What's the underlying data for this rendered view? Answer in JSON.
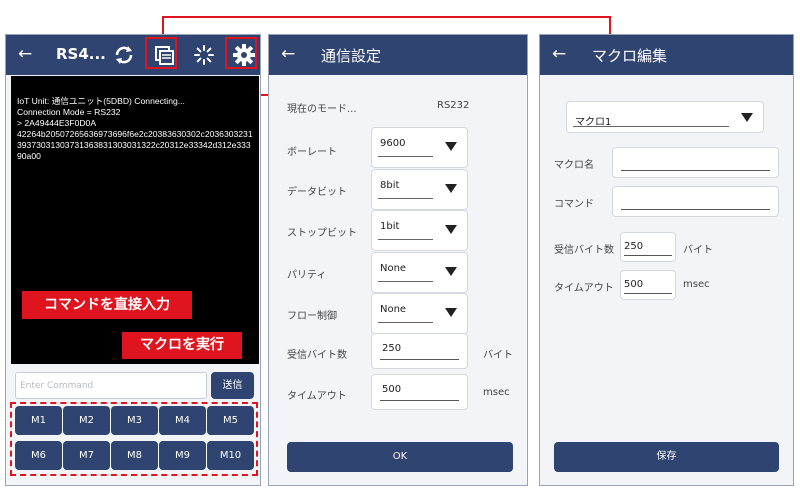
{
  "colors": {
    "header": "#2f4470",
    "highlight": "#e0141e",
    "terminal_bg": "#000000"
  },
  "screen1": {
    "back_icon": "back-arrow-icon",
    "title": "RS4...",
    "icons": [
      "refresh-icon",
      "copy-macro-icon",
      "loading-icon",
      "gear-icon"
    ],
    "terminal_lines": [
      "IoT Unit: 通信ユニット(5DBD) Connecting...",
      "Connection Mode = RS232",
      "> 2A49444E3F0D0A",
      "42264b20507265636973696f6e2c20383630302c203630323139373031303731363831303031322c20312e33342d312e33390a00"
    ],
    "command_placeholder": "Enter Command",
    "send_label": "送信",
    "callout_command": "コマンドを直接入力",
    "callout_macro": "マクロを実行",
    "macro_buttons": [
      "M1",
      "M2",
      "M3",
      "M4",
      "M5",
      "M6",
      "M7",
      "M8",
      "M9",
      "M10"
    ]
  },
  "screen2": {
    "title": "通信設定",
    "mode_label": "現在のモード...",
    "mode_value": "RS232",
    "baud_label": "ボーレート",
    "baud_value": "9600",
    "databit_label": "データビット",
    "databit_value": "8bit",
    "stopbit_label": "ストップビット",
    "stopbit_value": "1bit",
    "parity_label": "パリティ",
    "parity_value": "None",
    "flow_label": "フロー制御",
    "flow_value": "None",
    "recv_label": "受信バイト数",
    "recv_value": "250",
    "recv_unit": "バイト",
    "timeout_label": "タイムアウト",
    "timeout_value": "500",
    "timeout_unit": "msec",
    "ok_label": "OK"
  },
  "screen3": {
    "title": "マクロ編集",
    "macro_select": "マクロ1",
    "name_label": "マクロ名",
    "command_label": "コマンド",
    "recv_label": "受信バイト数",
    "recv_value": "250",
    "recv_unit": "バイト",
    "timeout_label": "タイムアウト",
    "timeout_value": "500",
    "timeout_unit": "msec",
    "save_label": "保存"
  }
}
